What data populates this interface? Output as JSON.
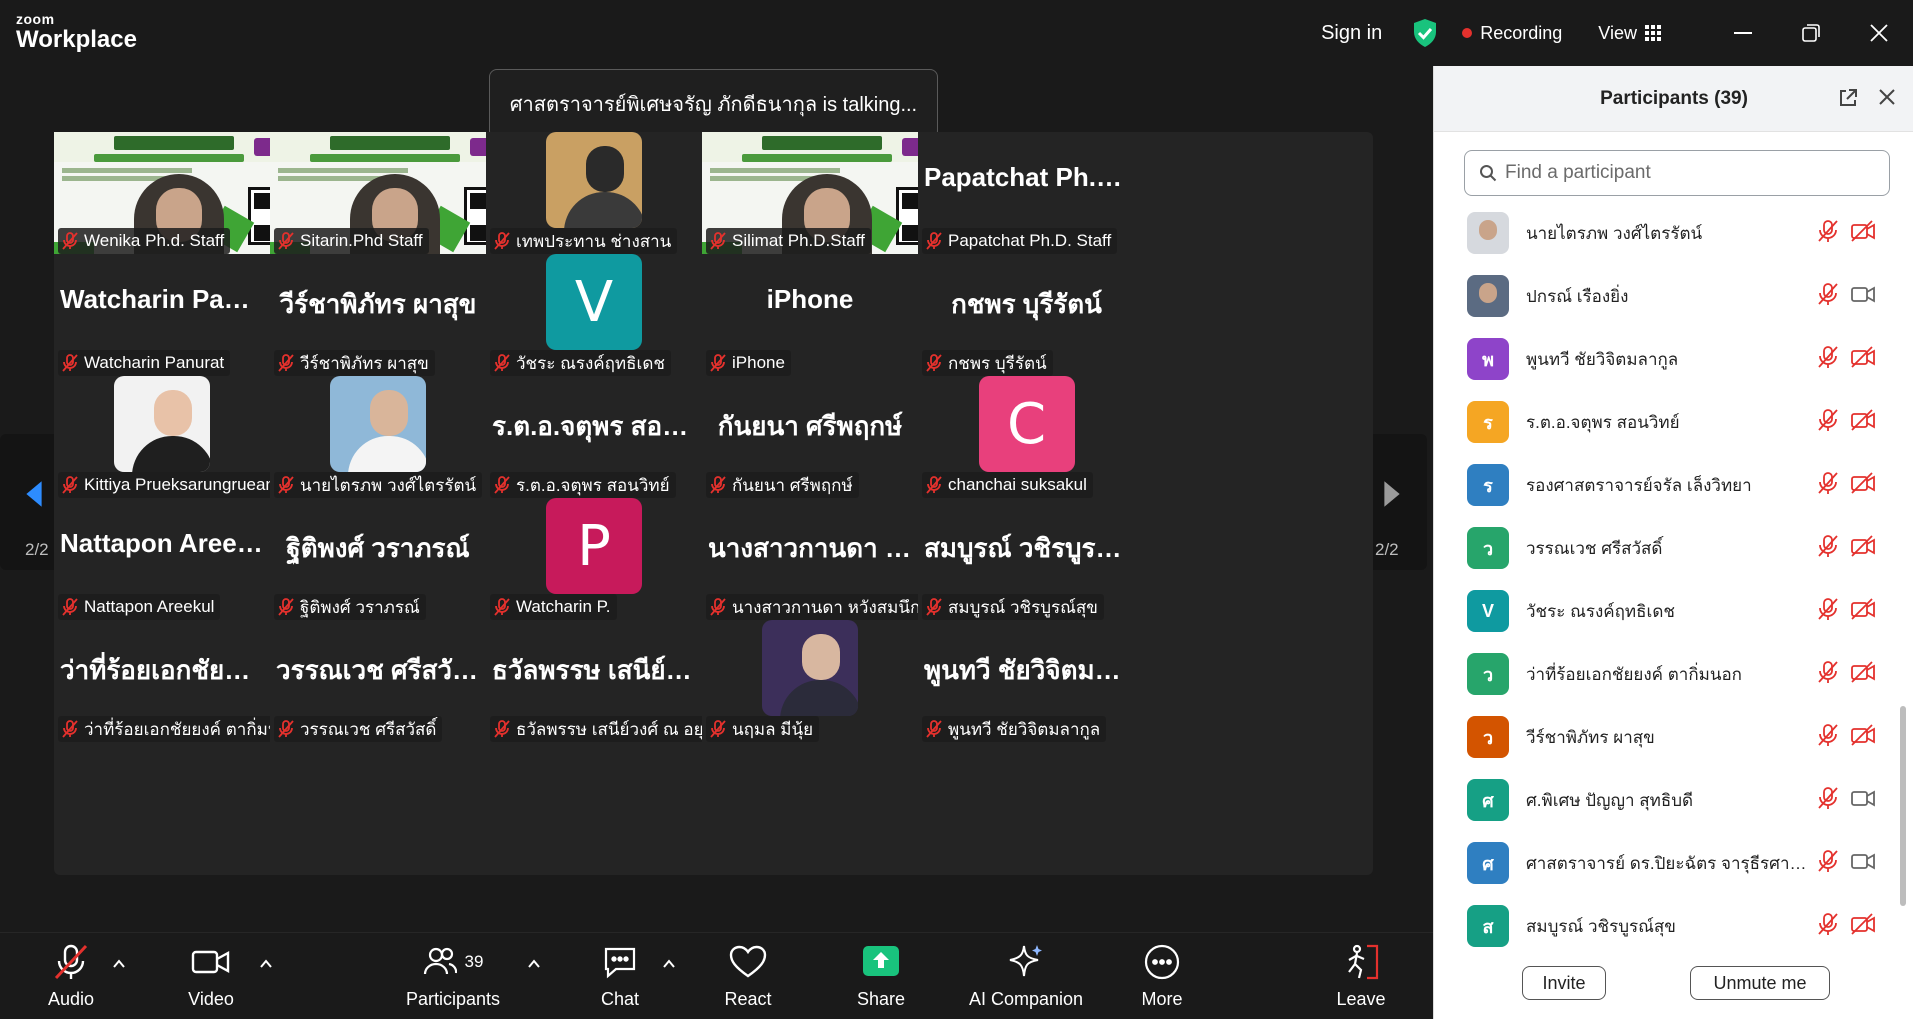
{
  "app": {
    "brand_small": "zoom",
    "brand_big": "Workplace"
  },
  "titlebar": {
    "sign_in": "Sign in",
    "recording": "Recording",
    "view": "View"
  },
  "talking_banner": "ศาสตราจารย์พิเศษจรัญ  ภักดีธนากุล is talking...",
  "pager": {
    "left": "2/2",
    "right": "2/2"
  },
  "tiles": [
    {
      "kind": "screen",
      "label": "Wenika Ph.d. Staff"
    },
    {
      "kind": "screen",
      "label": "Sitarin.Phd Staff"
    },
    {
      "kind": "photo",
      "label": "เทพประทาน ช่างสาน"
    },
    {
      "kind": "screen",
      "label": "Silimat Ph.D.Staff"
    },
    {
      "kind": "name",
      "big": "Papatchat  Ph.D. Staff",
      "label": "Papatchat Ph.D. Staff"
    },
    {
      "kind": "name",
      "big": "Watcharin  Panurat",
      "label": "Watcharin Panurat"
    },
    {
      "kind": "name",
      "big": "วีร์ชาพิภัทร ผาสุข",
      "label": "วีร์ชาพิภัทร ผาสุข"
    },
    {
      "kind": "letter",
      "letter": "V",
      "color": "#0f9aa0",
      "label": "วัชระ ณรงค์ฤทธิเดช"
    },
    {
      "kind": "name",
      "big": "iPhone",
      "label": "iPhone"
    },
    {
      "kind": "name",
      "big": "กชพร บุรีรัตน์",
      "label": "กชพร บุรีรัตน์"
    },
    {
      "kind": "photo",
      "label": "Kittiya Prueksarungrueang"
    },
    {
      "kind": "photo",
      "label": "นายไตรภพ วงศ์ไตรรัตน์"
    },
    {
      "kind": "name",
      "big": "ร.ต.อ.จตุพร  สอนวิทย์",
      "label": "ร.ต.อ.จตุพร สอนวิทย์"
    },
    {
      "kind": "name",
      "big": "กันยนา ศรีพฤกษ์",
      "label": "กันยนา ศรีพฤกษ์"
    },
    {
      "kind": "letter",
      "letter": "C",
      "color": "#e8407c",
      "label": "chanchai suksakul"
    },
    {
      "kind": "name",
      "big": "Nattapon Areekul",
      "label": "Nattapon Areekul"
    },
    {
      "kind": "name",
      "big": "ฐิติพงศ์ วราภรณ์",
      "label": "ฐิติพงศ์ วราภรณ์"
    },
    {
      "kind": "letter",
      "letter": "P",
      "color": "#c71a5b",
      "label": "Watcharin P."
    },
    {
      "kind": "name",
      "big": "นางสาวกานดา หวังสมนึก",
      "label": "นางสาวกานดา หวังสมนึก"
    },
    {
      "kind": "name",
      "big": "สมบูรณ์ วชิรบูรณ์สุข",
      "label": "สมบูรณ์ วชิรบูรณ์สุข"
    },
    {
      "kind": "name",
      "big": "ว่าที่ร้อยเอกชัยยงค์ ตากิ่มนอก",
      "label": "ว่าที่ร้อยเอกชัยยงค์ ตากิ่มนอก"
    },
    {
      "kind": "name",
      "big": "วรรณเวช ศรีสวัสดิ์",
      "label": "วรรณเวช ศรีสวัสดิ์"
    },
    {
      "kind": "name",
      "big": "ธวัลพรรษ เสนีย์วงศ์ ณ อยุธยา",
      "label": "ธวัลพรรษ เสนีย์วงศ์ ณ อยุธยา"
    },
    {
      "kind": "photo",
      "label": "นฤมล  มีนุ้ย"
    },
    {
      "kind": "name",
      "big": "พูนทวี ชัยวิจิตมลากูล",
      "label": "พูนทวี ชัยวิจิตมลากูล"
    }
  ],
  "toolbar": {
    "audio": "Audio",
    "video": "Video",
    "participants": "Participants",
    "participants_count": "39",
    "chat": "Chat",
    "react": "React",
    "share": "Share",
    "ai": "AI Companion",
    "more": "More",
    "leave": "Leave"
  },
  "panel": {
    "title": "Participants (39)",
    "search_placeholder": "Find a participant",
    "invite": "Invite",
    "unmute": "Unmute me",
    "participants": [
      {
        "name": "นายไตรภพ วงศ์ไตรรัตน์",
        "avatar": "photo",
        "cam_off": true
      },
      {
        "name": "ปกรณ์ เรืองยิ่ง",
        "avatar": "photo",
        "cam_off": false
      },
      {
        "name": "พูนทวี ชัยวิจิตมลากูล",
        "avatar": "พ",
        "color": "#8e44c9",
        "cam_off": true
      },
      {
        "name": "ร.ต.อ.จตุพร  สอนวิทย์",
        "avatar": "ร",
        "color": "#f5a623",
        "cam_off": true
      },
      {
        "name": "รองศาสตราจารย์จรัล  เล็งวิทยา",
        "avatar": "ร",
        "color": "#2f7fc1",
        "cam_off": true
      },
      {
        "name": "วรรณเวช ศรีสวัสดิ์",
        "avatar": "ว",
        "color": "#27a56b",
        "cam_off": true
      },
      {
        "name": "วัชระ ณรงค์ฤทธิเดช",
        "avatar": "V",
        "color": "#0f9aa0",
        "cam_off": true
      },
      {
        "name": "ว่าที่ร้อยเอกชัยยงค์ ตากิ่มนอก",
        "avatar": "ว",
        "color": "#27a56b",
        "cam_off": true
      },
      {
        "name": "วีร์ชาพิภัทร ผาสุข",
        "avatar": "ว",
        "color": "#d35400",
        "cam_off": true
      },
      {
        "name": "ศ.พิเศษ ปัญญา สุทธิบดี",
        "avatar": "ศ",
        "color": "#16a085",
        "cam_off": false
      },
      {
        "name": "ศาสตราจารย์ ดร.ปิยะฉัตร จารุธีรศาสตร์",
        "avatar": "ศ",
        "color": "#2f7fc1",
        "cam_off": false
      },
      {
        "name": "สมบูรณ์ วชิรบูรณ์สุข",
        "avatar": "ส",
        "color": "#16a085",
        "cam_off": true
      }
    ]
  },
  "colors": {
    "mute_red": "#e4312d",
    "share_green": "#19c37d",
    "recording_red": "#e4312d"
  }
}
